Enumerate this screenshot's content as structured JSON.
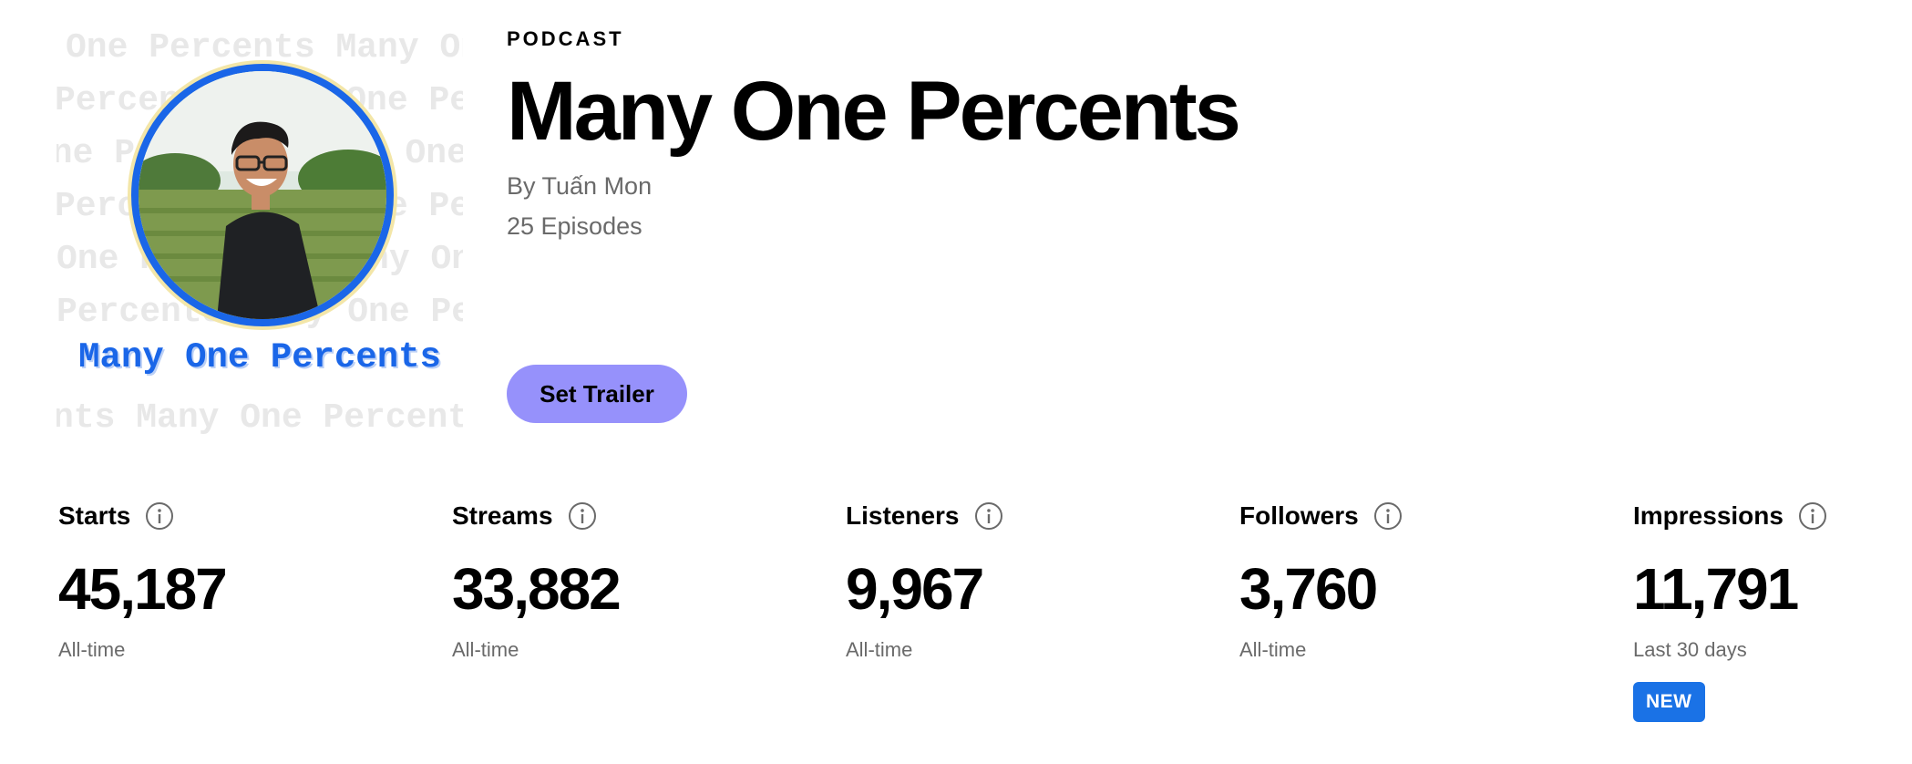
{
  "cover": {
    "pattern_rows": [
      "One Percents Many One",
      "Percents Many One Percents",
      "One Percents Many One Percents",
      "Percents Many One Percents",
      "One Percents Many One",
      "Percents Many One Percents",
      "nts Many One Percents"
    ],
    "title": "Many One Percents",
    "ring_color": "#1a66e8"
  },
  "header": {
    "kind": "PODCAST",
    "title": "Many One Percents",
    "author": "By Tuấn Mon",
    "episodes": "25 Episodes"
  },
  "actions": {
    "set_trailer_label": "Set Trailer",
    "set_trailer_color": "#9691fb"
  },
  "stats": [
    {
      "label": "Starts",
      "value": "45,187",
      "period": "All-time",
      "icon": "info-icon"
    },
    {
      "label": "Streams",
      "value": "33,882",
      "period": "All-time",
      "icon": "info-icon"
    },
    {
      "label": "Listeners",
      "value": "9,967",
      "period": "All-time",
      "icon": "info-icon"
    },
    {
      "label": "Followers",
      "value": "3,760",
      "period": "All-time",
      "icon": "info-icon"
    },
    {
      "label": "Impressions",
      "value": "11,791",
      "period": "Last 30 days",
      "icon": "info-icon",
      "badge": "NEW",
      "badge_color": "#1a72e6"
    }
  ]
}
